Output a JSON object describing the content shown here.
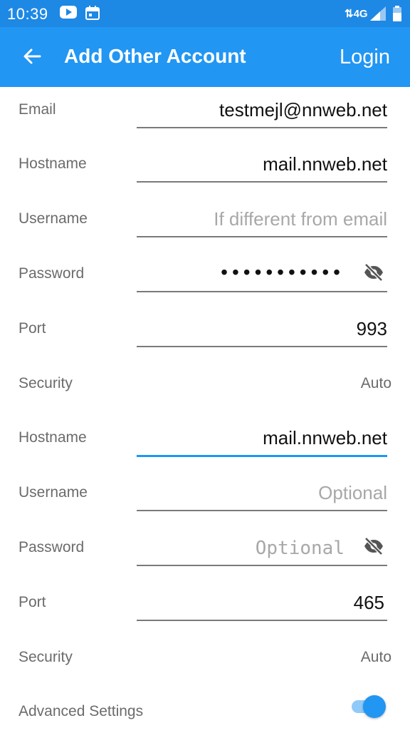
{
  "status_bar": {
    "time": "10:39",
    "network": "4G",
    "icons": [
      "youtube-icon",
      "calendar-icon",
      "signal-icon",
      "battery-icon"
    ]
  },
  "app_bar": {
    "title": "Add Other Account",
    "action": "Login",
    "icon": "arrow-back-icon"
  },
  "incoming": {
    "email": {
      "label": "Email",
      "value": "testmejl@nnweb.net"
    },
    "hostname": {
      "label": "Hostname",
      "value": "mail.nnweb.net"
    },
    "username": {
      "label": "Username",
      "placeholder": "If different from email"
    },
    "password": {
      "label": "Password",
      "value": "•••••••••••"
    },
    "port": {
      "label": "Port",
      "value": "993"
    },
    "security": {
      "label": "Security",
      "value": "Auto"
    }
  },
  "outgoing": {
    "hostname": {
      "label": "Hostname",
      "value": "mail.nnweb.net"
    },
    "username": {
      "label": "Username",
      "placeholder": "Optional"
    },
    "password": {
      "label": "Password",
      "placeholder": "Optional"
    },
    "port": {
      "label": "Port",
      "value": "465"
    },
    "security": {
      "label": "Security",
      "value": "Auto"
    }
  },
  "advanced": {
    "label": "Advanced Settings",
    "enabled": true
  },
  "colors": {
    "primary": "#2196f3",
    "status_bar": "#1e88e5",
    "toggle_track": "#90caf9"
  }
}
